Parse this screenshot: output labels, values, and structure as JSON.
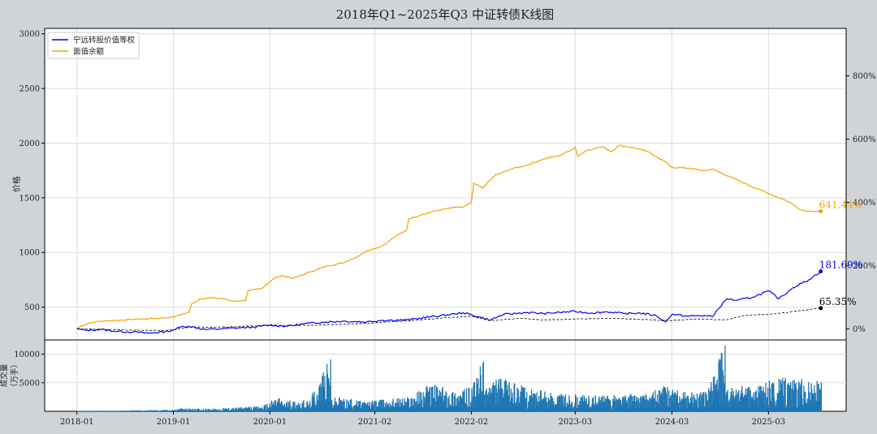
{
  "title": "2018年Q1~2025年Q3 中证转债K线图",
  "colors": {
    "background": "#d0d4d9",
    "plot_bg": "#ffffff",
    "grid": "#dcdcdc",
    "equity_line": "#0000ee",
    "face_value_line": "#f5a000",
    "index_line": "#000000",
    "volume_bar": "#1f77b4"
  },
  "chart_data": [
    {
      "type": "line",
      "ylabel": "价格",
      "ylim": [
        200,
        3050
      ],
      "y_ticks": [
        500,
        1000,
        1500,
        2000,
        2500,
        3000
      ],
      "y2_ticks": [
        "0%",
        "200%",
        "400%",
        "600%",
        "800%"
      ],
      "y2_tick_values": [
        0,
        200,
        400,
        600,
        800
      ],
      "y2lim": [
        -35,
        950
      ],
      "x_ticks": [
        "2018-01",
        "2019-01",
        "2020-01",
        "2021-02",
        "2022-02",
        "2023-03",
        "2024-03",
        "2025-03"
      ],
      "x_tick_values": [
        "2018-01-01",
        "2019-01-01",
        "2020-01-01",
        "2021-02-01",
        "2022-02-01",
        "2023-03-01",
        "2024-03-01",
        "2025-03-01"
      ],
      "xlim": [
        "2017-09-01",
        "2025-12-20"
      ],
      "grid": true,
      "legend": "top-left",
      "legend_entries": [
        {
          "label": "宁远转股价值等权",
          "color": "#0000ee"
        },
        {
          "label": "面值余额",
          "color": "#f5a000"
        }
      ],
      "end_labels": [
        {
          "text": "641.44%",
          "color": "#f5a000",
          "value": 641.44
        },
        {
          "text": "181.69%",
          "color": "#0000ee",
          "value": 181.69
        },
        {
          "text": "65.35%",
          "color": "#000000",
          "value": 65.35
        }
      ],
      "series": [
        {
          "name": "面值余额",
          "color": "#f5a000",
          "axis": "right",
          "points": [
            [
              "2018-01-01",
              0
            ],
            [
              "2018-01-15",
              8
            ],
            [
              "2018-02-15",
              18
            ],
            [
              "2018-04-01",
              24
            ],
            [
              "2018-06-01",
              27
            ],
            [
              "2018-08-01",
              30
            ],
            [
              "2018-10-01",
              32
            ],
            [
              "2018-12-01",
              35
            ],
            [
              "2019-01-01",
              38
            ],
            [
              "2019-03-01",
              52
            ],
            [
              "2019-03-10",
              78
            ],
            [
              "2019-04-15",
              96
            ],
            [
              "2019-05-15",
              98
            ],
            [
              "2019-07-01",
              96
            ],
            [
              "2019-08-15",
              88
            ],
            [
              "2019-10-01",
              89
            ],
            [
              "2019-10-10",
              119
            ],
            [
              "2019-12-01",
              128
            ],
            [
              "2020-01-15",
              159
            ],
            [
              "2020-02-15",
              168
            ],
            [
              "2020-04-01",
              160
            ],
            [
              "2020-06-01",
              180
            ],
            [
              "2020-08-01",
              198
            ],
            [
              "2020-10-01",
              208
            ],
            [
              "2020-12-01",
              230
            ],
            [
              "2021-01-01",
              247
            ],
            [
              "2021-03-01",
              262
            ],
            [
              "2021-05-01",
              298
            ],
            [
              "2021-06-01",
              312
            ],
            [
              "2021-06-10",
              348
            ],
            [
              "2021-08-01",
              362
            ],
            [
              "2021-10-01",
              375
            ],
            [
              "2021-12-01",
              384
            ],
            [
              "2022-01-01",
              385
            ],
            [
              "2022-02-01",
              398
            ],
            [
              "2022-02-10",
              460
            ],
            [
              "2022-03-15",
              445
            ],
            [
              "2022-05-01",
              485
            ],
            [
              "2022-07-01",
              505
            ],
            [
              "2022-09-01",
              518
            ],
            [
              "2022-11-01",
              537
            ],
            [
              "2023-01-01",
              548
            ],
            [
              "2023-02-15",
              566
            ],
            [
              "2023-03-01",
              575
            ],
            [
              "2023-03-10",
              546
            ],
            [
              "2023-04-15",
              565
            ],
            [
              "2023-06-15",
              576
            ],
            [
              "2023-07-15",
              560
            ],
            [
              "2023-08-15",
              580
            ],
            [
              "2023-10-01",
              574
            ],
            [
              "2023-12-01",
              560
            ],
            [
              "2024-01-01",
              545
            ],
            [
              "2024-02-01",
              530
            ],
            [
              "2024-03-01",
              510
            ],
            [
              "2024-05-01",
              508
            ],
            [
              "2024-07-01",
              500
            ],
            [
              "2024-08-01",
              505
            ],
            [
              "2024-10-01",
              483
            ],
            [
              "2024-12-01",
              460
            ],
            [
              "2025-02-01",
              438
            ],
            [
              "2025-03-15",
              423
            ],
            [
              "2025-05-01",
              408
            ],
            [
              "2025-06-01",
              394
            ],
            [
              "2025-07-01",
              376
            ],
            [
              "2025-08-01",
              372
            ],
            [
              "2025-09-15",
              641.44
            ]
          ]
        },
        {
          "name": "宁远转股价值等权",
          "color": "#0000ee",
          "axis": "right",
          "points": [
            [
              "2018-01-01",
              0
            ],
            [
              "2018-02-01",
              -5
            ],
            [
              "2018-04-01",
              -2
            ],
            [
              "2018-06-01",
              -8
            ],
            [
              "2018-08-01",
              -10
            ],
            [
              "2018-10-01",
              -14
            ],
            [
              "2018-12-01",
              -9
            ],
            [
              "2019-01-01",
              -4
            ],
            [
              "2019-02-01",
              7
            ],
            [
              "2019-03-01",
              8
            ],
            [
              "2019-05-01",
              -2
            ],
            [
              "2019-07-01",
              0
            ],
            [
              "2019-09-01",
              3
            ],
            [
              "2019-11-01",
              5
            ],
            [
              "2020-01-01",
              12
            ],
            [
              "2020-03-01",
              8
            ],
            [
              "2020-06-01",
              18
            ],
            [
              "2020-08-01",
              22
            ],
            [
              "2020-10-01",
              24
            ],
            [
              "2021-01-01",
              22
            ],
            [
              "2021-03-01",
              27
            ],
            [
              "2021-06-01",
              28
            ],
            [
              "2021-09-01",
              38
            ],
            [
              "2021-12-01",
              47
            ],
            [
              "2022-01-01",
              51
            ],
            [
              "2022-03-01",
              38
            ],
            [
              "2022-04-15",
              28
            ],
            [
              "2022-06-01",
              45
            ],
            [
              "2022-09-01",
              52
            ],
            [
              "2022-11-01",
              48
            ],
            [
              "2023-01-01",
              52
            ],
            [
              "2023-03-01",
              55
            ],
            [
              "2023-05-01",
              50
            ],
            [
              "2023-07-01",
              54
            ],
            [
              "2023-09-01",
              48
            ],
            [
              "2023-11-01",
              50
            ],
            [
              "2024-01-01",
              42
            ],
            [
              "2024-02-05",
              22
            ],
            [
              "2024-03-01",
              46
            ],
            [
              "2024-05-01",
              40
            ],
            [
              "2024-07-01",
              42
            ],
            [
              "2024-08-01",
              38
            ],
            [
              "2024-08-20",
              60
            ],
            [
              "2024-09-25",
              95
            ],
            [
              "2024-11-01",
              90
            ],
            [
              "2025-01-01",
              100
            ],
            [
              "2025-03-01",
              120
            ],
            [
              "2025-04-10",
              95
            ],
            [
              "2025-06-01",
              130
            ],
            [
              "2025-08-01",
              155
            ],
            [
              "2025-09-15",
              181.69
            ]
          ]
        },
        {
          "name": "中证转债",
          "color": "#000000",
          "axis": "right",
          "points": [
            [
              "2018-01-01",
              0
            ],
            [
              "2018-06-01",
              -3
            ],
            [
              "2018-12-01",
              -6
            ],
            [
              "2019-03-01",
              5
            ],
            [
              "2019-08-01",
              6
            ],
            [
              "2019-12-01",
              10
            ],
            [
              "2020-06-01",
              11
            ],
            [
              "2020-12-01",
              16
            ],
            [
              "2021-06-01",
              25
            ],
            [
              "2021-12-01",
              37
            ],
            [
              "2022-02-01",
              40
            ],
            [
              "2022-04-15",
              26
            ],
            [
              "2022-08-01",
              33
            ],
            [
              "2022-11-01",
              28
            ],
            [
              "2023-03-01",
              31
            ],
            [
              "2023-08-01",
              33
            ],
            [
              "2023-12-01",
              29
            ],
            [
              "2024-02-05",
              25
            ],
            [
              "2024-06-01",
              31
            ],
            [
              "2024-09-20",
              28
            ],
            [
              "2024-12-01",
              42
            ],
            [
              "2025-04-01",
              48
            ],
            [
              "2025-09-15",
              65.35
            ]
          ]
        }
      ]
    },
    {
      "type": "bar",
      "ylabel": "成交量\n（万手）",
      "ylim": [
        0,
        12500
      ],
      "y_ticks": [
        5000,
        10000
      ],
      "volume_profile": [
        [
          "2018-01-01",
          80
        ],
        [
          "2018-06-01",
          120
        ],
        [
          "2019-01-01",
          300
        ],
        [
          "2019-03-01",
          800
        ],
        [
          "2019-07-01",
          600
        ],
        [
          "2019-12-01",
          900
        ],
        [
          "2020-02-01",
          2800
        ],
        [
          "2020-06-01",
          2600
        ],
        [
          "2020-08-15",
          9500
        ],
        [
          "2020-10-01",
          2400
        ],
        [
          "2021-01-01",
          1800
        ],
        [
          "2021-06-01",
          2600
        ],
        [
          "2021-09-01",
          5000
        ],
        [
          "2021-12-01",
          3800
        ],
        [
          "2022-02-01",
          4200
        ],
        [
          "2022-03-15",
          9200
        ],
        [
          "2022-05-01",
          6200
        ],
        [
          "2022-07-15",
          5000
        ],
        [
          "2022-10-01",
          3800
        ],
        [
          "2023-01-01",
          3200
        ],
        [
          "2023-06-01",
          2800
        ],
        [
          "2023-12-01",
          3200
        ],
        [
          "2024-02-01",
          4500
        ],
        [
          "2024-04-01",
          3500
        ],
        [
          "2024-07-01",
          3400
        ],
        [
          "2024-09-15",
          12000
        ],
        [
          "2024-11-01",
          5000
        ],
        [
          "2025-01-01",
          4200
        ],
        [
          "2025-04-01",
          6000
        ],
        [
          "2025-09-15",
          5500
        ]
      ]
    }
  ]
}
